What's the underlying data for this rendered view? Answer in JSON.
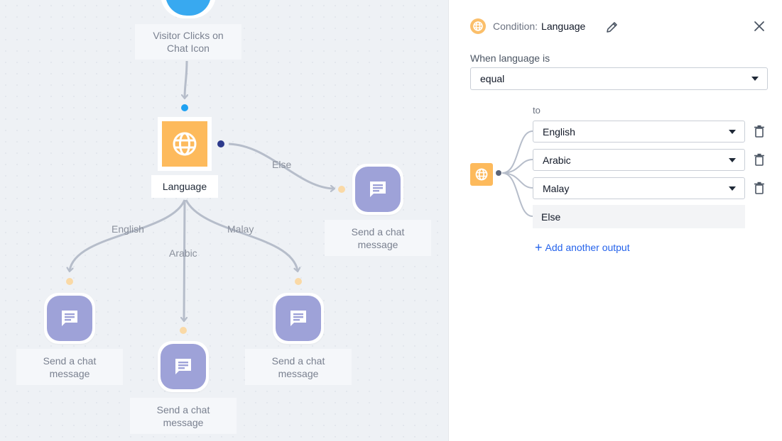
{
  "canvas": {
    "trigger_label": "Visitor Clicks on Chat Icon",
    "condition_label": "Language",
    "edges": {
      "else": "Else",
      "english": "English",
      "arabic": "Arabic",
      "malay": "Malay"
    },
    "message_nodes": [
      {
        "label": "Send a chat message"
      },
      {
        "label": "Send a chat message"
      },
      {
        "label": "Send a chat message"
      },
      {
        "label": "Send a chat message"
      }
    ]
  },
  "panel": {
    "header_prefix": "Condition:",
    "header_title": "Language",
    "when_label": "When language is",
    "operator_value": "equal",
    "to_label": "to",
    "outputs": [
      {
        "value": "English"
      },
      {
        "value": "Arabic"
      },
      {
        "value": "Malay"
      }
    ],
    "else_label": "Else",
    "add_output_label": "Add another output"
  },
  "colors": {
    "condition_orange": "#fdba5c",
    "message_purple": "#9ea2d8",
    "trigger_blue": "#38a9f0",
    "edge_gray": "#b6bdca",
    "link_blue": "#2563eb"
  },
  "icons": {
    "condition": "globe-icon",
    "message": "chat-message-icon",
    "edit": "pencil-icon",
    "close": "close-icon",
    "delete": "trash-icon",
    "add": "plus-icon"
  }
}
